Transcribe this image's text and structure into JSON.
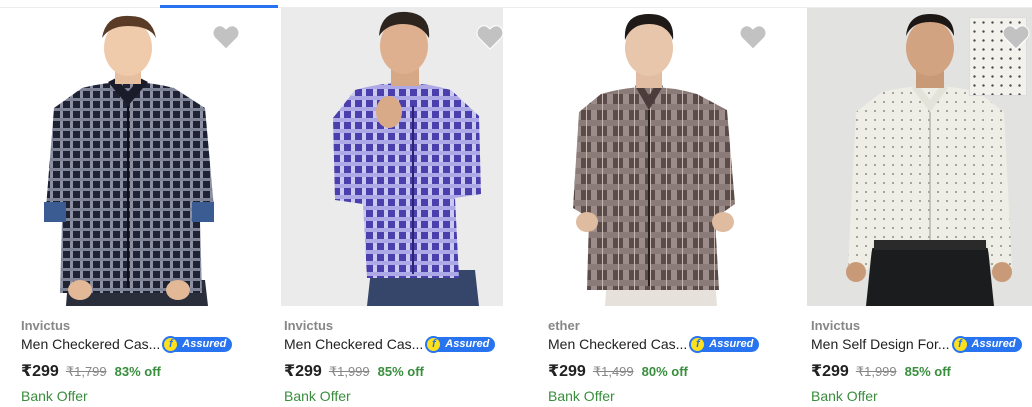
{
  "products": [
    {
      "brand": "Invictus",
      "title": "Men Checkered Cas...",
      "assured_label": "Assured",
      "price": "₹299",
      "mrp": "₹1,799",
      "discount": "83% off",
      "offer": "Bank Offer",
      "image": "man-in-navy-checkered-shirt"
    },
    {
      "brand": "Invictus",
      "title": "Men Checkered Cas...",
      "assured_label": "Assured",
      "price": "₹299",
      "mrp": "₹1,999",
      "discount": "85% off",
      "offer": "Bank Offer",
      "image": "man-in-purple-checkered-shirt"
    },
    {
      "brand": "ether",
      "title": "Men Checkered Cas...",
      "assured_label": "Assured",
      "price": "₹299",
      "mrp": "₹1,499",
      "discount": "80% off",
      "offer": "Bank Offer",
      "image": "man-in-brown-checkered-shirt"
    },
    {
      "brand": "Invictus",
      "title": "Men Self Design For...",
      "assured_label": "Assured",
      "price": "₹299",
      "mrp": "₹1,999",
      "discount": "85% off",
      "offer": "Bank Offer",
      "image": "man-in-white-printed-formal-shirt"
    }
  ],
  "icons": {
    "wishlist": "heart-icon",
    "assured": "assured-badge-icon"
  },
  "colors": {
    "accent": "#2874f0",
    "discount": "#388e3c",
    "assured_badge": "#ffe11b",
    "heart": "#c2c2c2"
  }
}
